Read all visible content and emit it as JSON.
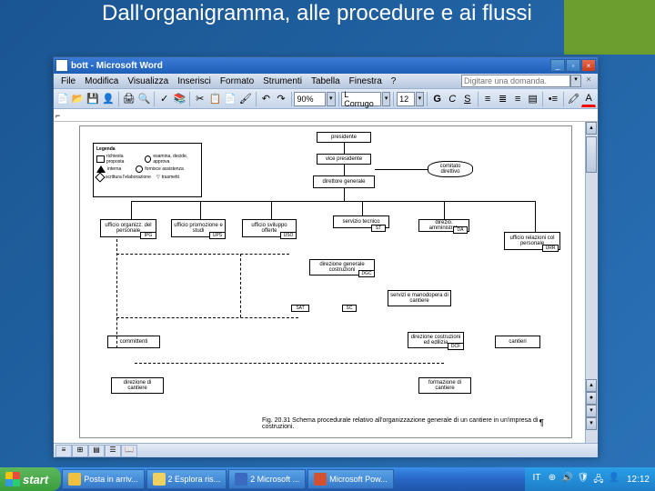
{
  "slide": {
    "title": "Dall'organigramma, alle procedure e ai flussi"
  },
  "word": {
    "title": "bott - Microsoft Word",
    "menu": {
      "file": "File",
      "edit": "Modifica",
      "view": "Visualizza",
      "insert": "Inserisci",
      "format": "Formato",
      "tools": "Strumenti",
      "table": "Tabella",
      "window": "Finestra",
      "help": "?"
    },
    "help_placeholder": "Digitare una domanda.",
    "zoom": "90%",
    "style": "L Corrugo",
    "font_size": "12",
    "bold": "G",
    "italic": "C",
    "underline": "S"
  },
  "diagram": {
    "legend_title": "Legenda",
    "legend": {
      "richiesta": "richiesta proposta",
      "interna": "interna",
      "scrittura": "scrittura l'elaborazione",
      "approva": "esamina, decide, approva",
      "assistenza": "fornisce assistenza",
      "trasmetti": "trasmetti"
    },
    "boxes": {
      "presidente": "presidente",
      "vice_presidente": "vice presidente",
      "direttore_generale": "direttore generale",
      "comitato": "comitato direttivo",
      "ufficio_organizz": "ufficio organizz. del personale",
      "ufficio_promozione": "ufficio promozione e studi",
      "ufficio_sviluppo": "ufficio sviluppo offerte",
      "servizio_tecnico": "servizio tecnico",
      "direzio_ammin": "direzio. amministrat.",
      "ufficio_relazioni": "ufficio relazioni col personale",
      "direzione_generale": "direzione generale costruzioni",
      "servizi_manodopera": "servizi e manodopera di cantiere",
      "committenti": "committenti",
      "direzione_costruz": "direzione costruzioni ed edilizia",
      "cantieri": "cantieri",
      "direzione_cantiere": "direzione di cantiere",
      "formazione": "formazione di cantiere"
    },
    "codes": {
      "ipg": "IPG",
      "ups": "UPS",
      "uso": "USO",
      "st": "ST",
      "da": "DA",
      "urr": "URR",
      "dgc": "DGC",
      "sat": "SAT",
      "sc": "SC",
      "dcf": "DCF"
    },
    "caption": "Fig. 20.31   Schema procedurale relativo all'organizzazione generale di un cantiere in un'impresa di costruzioni."
  },
  "taskbar": {
    "start": "start",
    "items": [
      "Posta in arriv...",
      "2 Esplora ris...",
      "2 Microsoft ...",
      "Microsoft Pow..."
    ],
    "clock": "12:12"
  }
}
